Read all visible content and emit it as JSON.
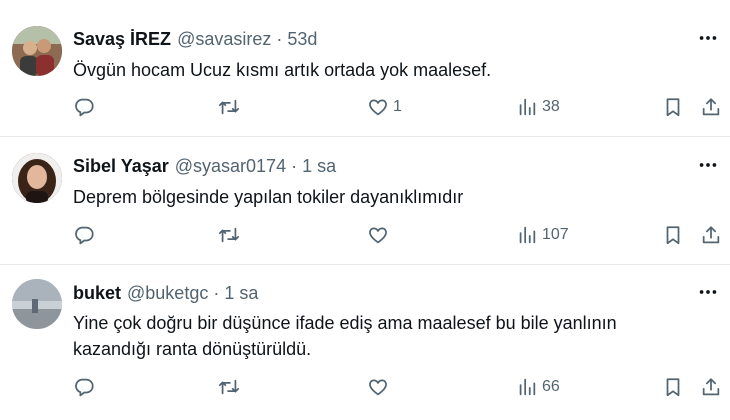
{
  "tweets": [
    {
      "name": "Savaş İREZ",
      "handle": "@savasirez",
      "separator": "·",
      "time": "53d",
      "text": "Övgün hocam Ucuz kısmı artık ortada yok maalesef.",
      "likes": "1",
      "views": "38",
      "avatar_colors": [
        "#6b4a3a",
        "#c29a78",
        "#3a3a3a"
      ]
    },
    {
      "name": "Sibel Yaşar",
      "handle": "@syasar0174",
      "separator": "·",
      "time": "1 sa",
      "text": "Deprem bölgesinde yapılan tokiler dayanıklımıdır",
      "likes": "",
      "views": "107",
      "avatar_colors": [
        "#3a2418",
        "#e0b49a",
        "#1e1512"
      ]
    },
    {
      "name": "buket",
      "handle": "@buketgc",
      "separator": "·",
      "time": "1 sa",
      "text": "Yine çok doğru bir düşünce ifade ediş ama maalesef bu bile yanlının kazandığı ranta dönüştürüldü.",
      "likes": "",
      "views": "66",
      "avatar_colors": [
        "#c5ccd2",
        "#8b9096",
        "#5f6a74"
      ]
    }
  ],
  "icons": {
    "more": "more-icon",
    "reply": "reply-icon",
    "retweet": "retweet-icon",
    "like": "like-icon",
    "views": "views-icon",
    "bookmark": "bookmark-icon",
    "share": "share-icon"
  }
}
